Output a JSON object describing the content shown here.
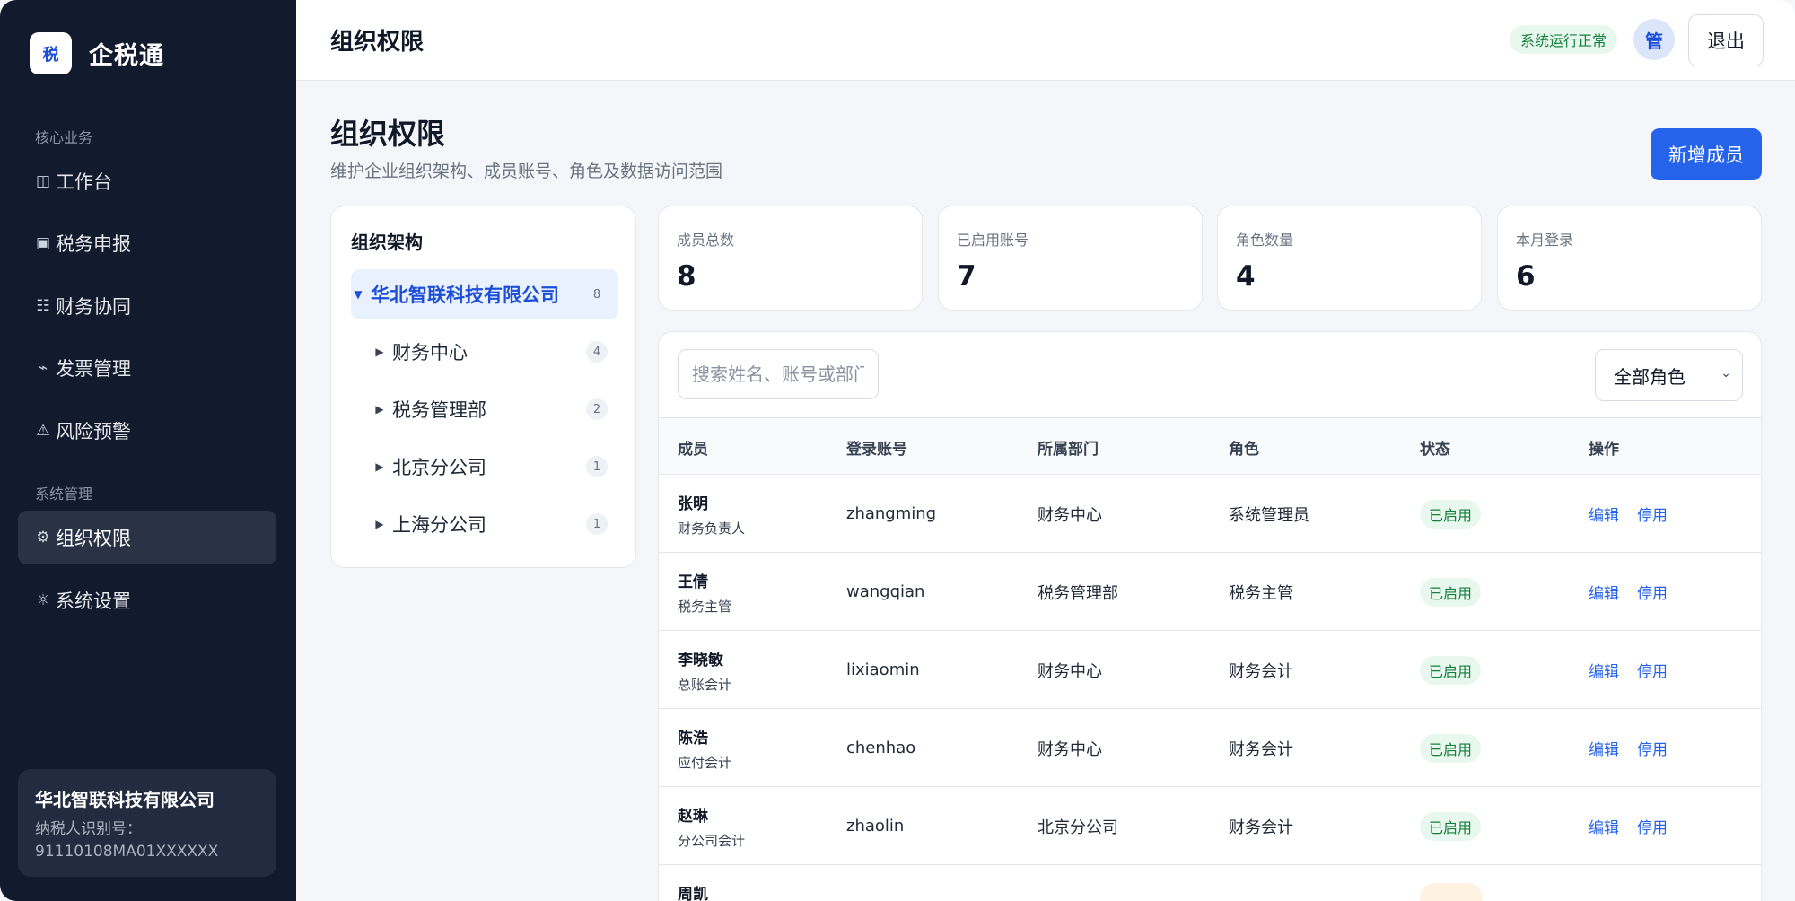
{
  "brand": {
    "logo_char": "税",
    "name": "企税通"
  },
  "sidebar": {
    "group_core": "核心业务",
    "group_system": "系统管理",
    "items": [
      {
        "icon": "◫",
        "icon_name": "dashboard-icon",
        "label": "工作台"
      },
      {
        "icon": "▣",
        "icon_name": "tax-filing-icon",
        "label": "税务申报"
      },
      {
        "icon": "☷",
        "icon_name": "list-icon",
        "label": "财务协同"
      },
      {
        "icon": "⌁",
        "icon_name": "invoice-icon",
        "label": "发票管理"
      },
      {
        "icon": "⚠",
        "icon_name": "warning-icon",
        "label": "风险预警"
      },
      {
        "icon": "⚙",
        "icon_name": "gear-icon",
        "label": "组织权限"
      },
      {
        "icon": "☼",
        "icon_name": "settings-icon",
        "label": "系统设置"
      }
    ],
    "active_index": 5,
    "company": {
      "name": "华北智联科技有限公司",
      "tax_label": "纳税人识别号：",
      "tax_id": "91110108MA01XXXXXX"
    }
  },
  "header": {
    "title": "组织权限",
    "status": "系统运行正常",
    "avatar": "管",
    "logout": "退出"
  },
  "page": {
    "title": "组织权限",
    "subtitle": "维护企业组织架构、成员账号、角色及数据访问范围",
    "add_button": "新增成员"
  },
  "org": {
    "title": "组织架构",
    "root": {
      "label": "华北智联科技有限公司",
      "count": "8",
      "caret": "▼"
    },
    "children": [
      {
        "label": "财务中心",
        "count": "4",
        "caret": "▶"
      },
      {
        "label": "税务管理部",
        "count": "2",
        "caret": "▶"
      },
      {
        "label": "北京分公司",
        "count": "1",
        "caret": "▶"
      },
      {
        "label": "上海分公司",
        "count": "1",
        "caret": "▶"
      }
    ]
  },
  "stats": [
    {
      "label": "成员总数",
      "value": "8"
    },
    {
      "label": "已启用账号",
      "value": "7"
    },
    {
      "label": "角色数量",
      "value": "4"
    },
    {
      "label": "本月登录",
      "value": "6"
    }
  ],
  "table": {
    "search_placeholder": "搜索姓名、账号或部门",
    "role_filter": "全部角色",
    "role_filter_icon": "chevron-down-icon",
    "columns": [
      "成员",
      "登录账号",
      "所属部门",
      "角色",
      "状态",
      "操作"
    ],
    "edit_label": "编辑",
    "disable_label": "停用",
    "rows": [
      {
        "name": "张明",
        "title": "财务负责人",
        "account": "zhangming",
        "dept": "财务中心",
        "role": "系统管理员",
        "status": "已启用"
      },
      {
        "name": "王倩",
        "title": "税务主管",
        "account": "wangqian",
        "dept": "税务管理部",
        "role": "税务主管",
        "status": "已启用"
      },
      {
        "name": "李晓敏",
        "title": "总账会计",
        "account": "lixiaomin",
        "dept": "财务中心",
        "role": "财务会计",
        "status": "已启用"
      },
      {
        "name": "陈浩",
        "title": "应付会计",
        "account": "chenhao",
        "dept": "财务中心",
        "role": "财务会计",
        "status": "已启用"
      },
      {
        "name": "赵琳",
        "title": "分公司会计",
        "account": "zhaolin",
        "dept": "北京分公司",
        "role": "财务会计",
        "status": "已启用"
      },
      {
        "name": "周凯",
        "title": "",
        "account": "",
        "dept": "",
        "role": "",
        "status": ""
      }
    ]
  },
  "colors": {
    "sidebar_bg": "#121a2e",
    "accent": "#2563eb",
    "status_ok_bg": "#e9f8ef",
    "status_ok_text": "#15803d",
    "status_warn_bg": "#fef3e2"
  }
}
